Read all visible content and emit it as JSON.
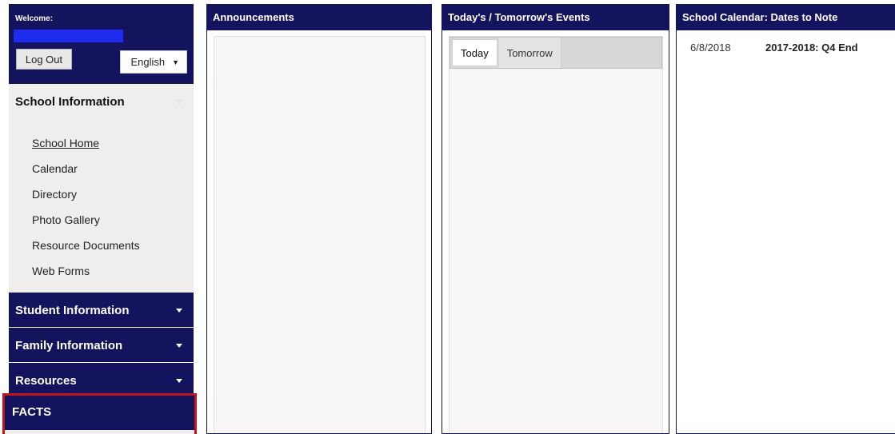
{
  "sidebar": {
    "welcome_label": "Welcome:",
    "logout_label": "Log Out",
    "language": {
      "selected": "English"
    },
    "school_info": {
      "title": "School Information",
      "items": [
        {
          "label": "School Home",
          "active": true
        },
        {
          "label": "Calendar"
        },
        {
          "label": "Directory"
        },
        {
          "label": "Photo Gallery"
        },
        {
          "label": "Resource Documents"
        },
        {
          "label": "Web Forms"
        }
      ]
    },
    "sections": [
      {
        "label": "Student Information"
      },
      {
        "label": "Family Information"
      },
      {
        "label": "Resources"
      }
    ],
    "facts_label": "FACTS"
  },
  "panels": {
    "announcements": {
      "title": "Announcements"
    },
    "events": {
      "title": "Today's / Tomorrow's Events",
      "tabs": [
        {
          "label": "Today",
          "active": true
        },
        {
          "label": "Tomorrow"
        }
      ]
    },
    "calendar": {
      "title": "School Calendar: Dates to Note",
      "entries": [
        {
          "date": "6/8/2018",
          "title": "2017-2018: Q4 End"
        }
      ]
    }
  },
  "colors": {
    "navy": "#13135e",
    "highlight_border": "#c0151d",
    "redaction": "#1e2cf0"
  }
}
